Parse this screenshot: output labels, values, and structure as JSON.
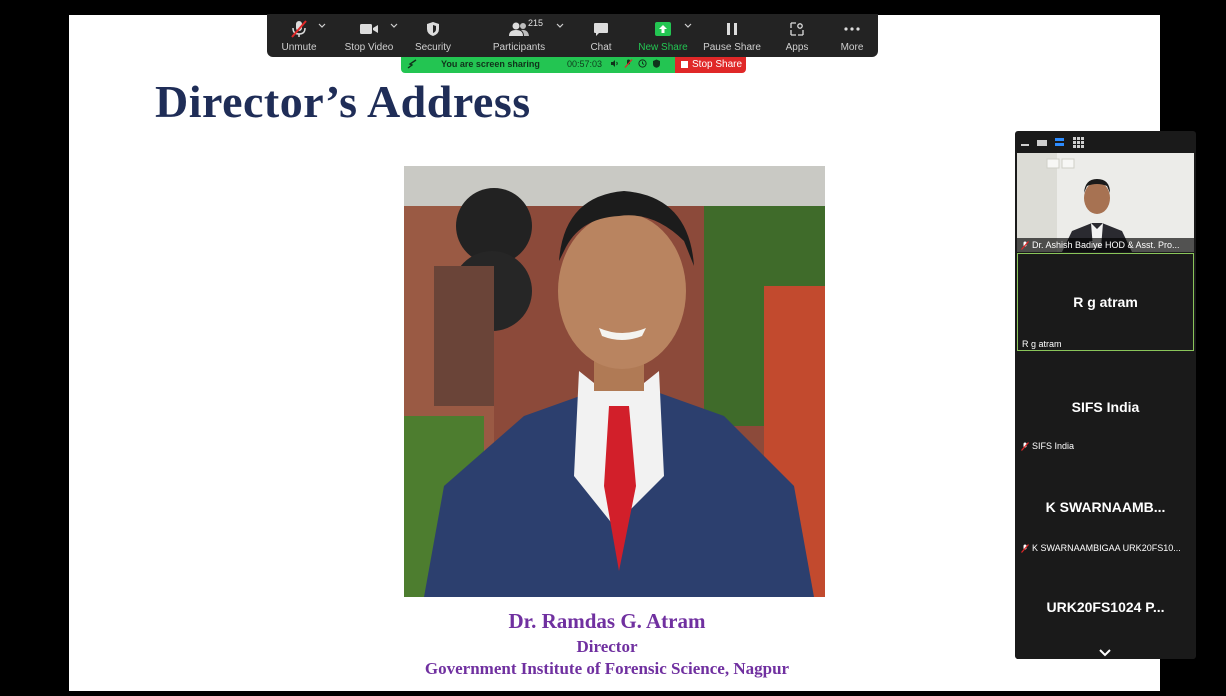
{
  "toolbar": {
    "unmute": "Unmute",
    "stop_video": "Stop Video",
    "security": "Security",
    "participants": "Participants",
    "participant_count": "215",
    "chat": "Chat",
    "new_share": "New Share",
    "pause_share": "Pause Share",
    "apps": "Apps",
    "more": "More"
  },
  "share_bar": {
    "status": "You are screen sharing",
    "elapsed": "00:57:03",
    "stop_share": "Stop Share"
  },
  "slide": {
    "title": "Director’s Address",
    "name": "Dr. Ramdas G. Atram",
    "role": "Director",
    "institution": "Government Institute of Forensic Science, Nagpur"
  },
  "gallery": {
    "tiles": [
      {
        "label": "Dr. Ashish Badiye HOD & Asst. Pro..."
      },
      {
        "display": "R g atram",
        "label": "R g atram"
      },
      {
        "display": "SIFS India",
        "label": "SIFS India"
      },
      {
        "display": "K  SWARNAAMB...",
        "label": "K SWARNAAMBIGAA URK20FS10..."
      },
      {
        "display": "URK20FS1024  P..."
      }
    ]
  },
  "colors": {
    "slide_title": "#1f2d57",
    "caption": "#7030a0",
    "share_green": "#23c552",
    "stop_red": "#e02828",
    "active_speaker": "#8ac55a"
  },
  "icons": [
    "mic-muted-icon",
    "video-camera-icon",
    "shield-icon",
    "participants-icon",
    "chat-bubble-icon",
    "share-arrow-icon",
    "pause-icon",
    "apps-icon",
    "more-dots-icon",
    "chevron-down-icon"
  ]
}
